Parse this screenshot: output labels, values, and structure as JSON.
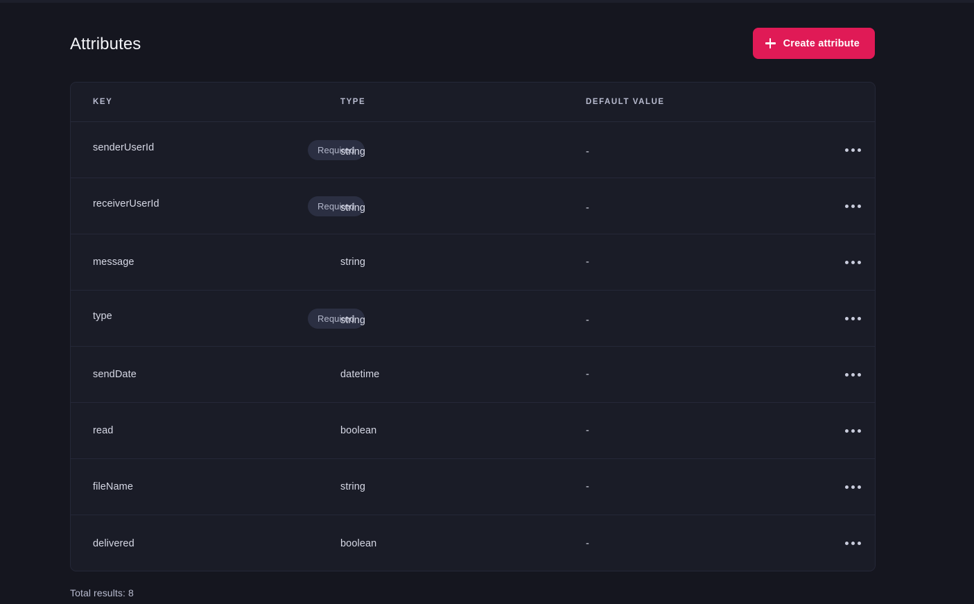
{
  "header": {
    "title": "Attributes",
    "create_button": {
      "label": "Create attribute",
      "icon": "plus-icon",
      "color": "#e01a56"
    }
  },
  "table": {
    "columns": [
      "KEY",
      "TYPE",
      "DEFAULT VALUE"
    ],
    "badge_required_label": "Required",
    "row_action_icon": "more-horizontal-icon",
    "rows": [
      {
        "key": "senderUserId",
        "required": true,
        "badge": "Required",
        "type": "string",
        "default": "-"
      },
      {
        "key": "receiverUserId",
        "required": true,
        "badge": "Required",
        "type": "string",
        "default": "-"
      },
      {
        "key": "message",
        "required": false,
        "badge": "",
        "type": "string",
        "default": "-"
      },
      {
        "key": "type",
        "required": true,
        "badge": "Required",
        "type": "string",
        "default": "-"
      },
      {
        "key": "sendDate",
        "required": false,
        "badge": "",
        "type": "datetime",
        "default": "-"
      },
      {
        "key": "read",
        "required": false,
        "badge": "",
        "type": "boolean",
        "default": "-"
      },
      {
        "key": "fileName",
        "required": false,
        "badge": "",
        "type": "string",
        "default": "-"
      },
      {
        "key": "delivered",
        "required": false,
        "badge": "",
        "type": "boolean",
        "default": "-"
      }
    ]
  },
  "footer": {
    "total_results": "Total results: 8"
  }
}
